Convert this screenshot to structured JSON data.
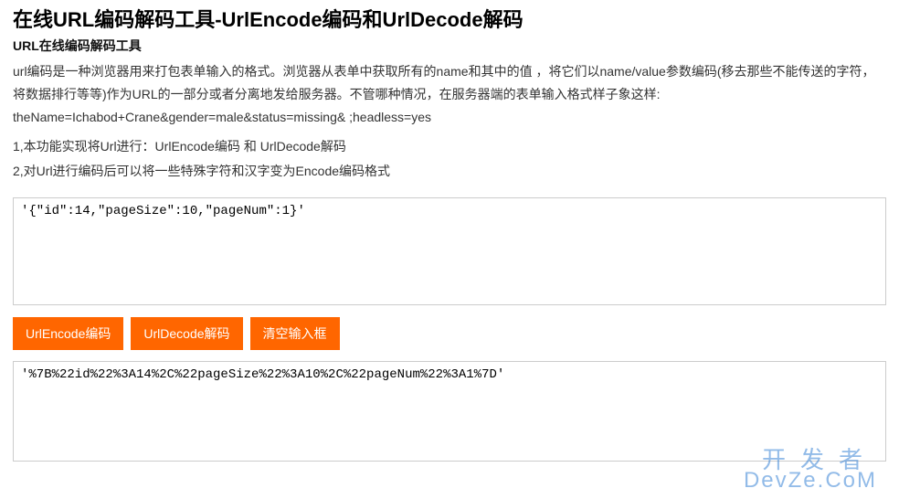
{
  "header": {
    "title": "在线URL编码解码工具-UrlEncode编码和UrlDecode解码",
    "subtitle": "URL在线编码解码工具"
  },
  "description": "url编码是一种浏览器用来打包表单输入的格式。浏览器从表单中获取所有的name和其中的值 ，将它们以name/value参数编码(移去那些不能传送的字符，将数据排行等等)作为URL的一部分或者分离地发给服务器。不管哪种情况，在服务器端的表单输入格式样子象这样: theName=Ichabod+Crane&gender=male&status=missing& ;headless=yes",
  "notes": {
    "line1": "1,本功能实现将Url进行：UrlEncode编码 和 UrlDecode解码",
    "line2": "2,对Url进行编码后可以将一些特殊字符和汉字变为Encode编码格式"
  },
  "input": {
    "value": "'{\"id\":14,\"pageSize\":10,\"pageNum\":1}'"
  },
  "buttons": {
    "encode": "UrlEncode编码",
    "decode": "UrlDecode解码",
    "clear": "清空输入框"
  },
  "output": {
    "value": "'%7B%22id%22%3A14%2C%22pageSize%22%3A10%2C%22pageNum%22%3A1%7D'"
  },
  "watermark": {
    "cn": "开发者",
    "en": "DevZe.CoM"
  }
}
